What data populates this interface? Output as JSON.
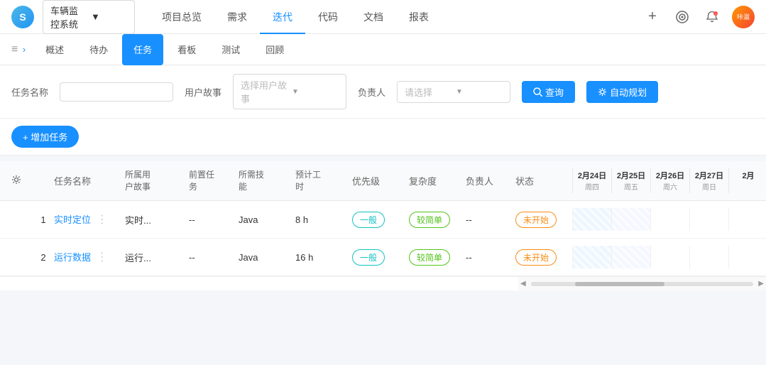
{
  "topNav": {
    "logo": "S",
    "projectSelector": {
      "label": "车辆监控系统",
      "chevron": "▼"
    },
    "navItems": [
      {
        "id": "overview",
        "label": "项目总览",
        "active": false
      },
      {
        "id": "requirements",
        "label": "需求",
        "active": false
      },
      {
        "id": "iteration",
        "label": "迭代",
        "active": true
      },
      {
        "id": "code",
        "label": "代码",
        "active": false
      },
      {
        "id": "docs",
        "label": "文档",
        "active": false
      },
      {
        "id": "reports",
        "label": "报表",
        "active": false
      }
    ],
    "icons": {
      "plus": "+",
      "target": "◎",
      "bell": "①"
    },
    "avatar": "咔滋咔滋嗡"
  },
  "secondNav": {
    "expandIcon": "≡",
    "items": [
      {
        "id": "overview2",
        "label": "概述",
        "active": false
      },
      {
        "id": "pending",
        "label": "待办",
        "active": false
      },
      {
        "id": "task",
        "label": "任务",
        "active": true
      },
      {
        "id": "kanban",
        "label": "看板",
        "active": false
      },
      {
        "id": "test",
        "label": "测试",
        "active": false
      },
      {
        "id": "review",
        "label": "回顾",
        "active": false
      }
    ]
  },
  "filterBar": {
    "taskNameLabel": "任务名称",
    "taskNamePlaceholder": "",
    "userStoryLabel": "用户故事",
    "userStoryPlaceholder": "选择用户故事",
    "assigneeLabel": "负责人",
    "assigneePlaceholder": "请选择",
    "queryBtn": "查询",
    "autoPlanBtn": "自动规划"
  },
  "actionBar": {
    "addTaskBtn": "+ 增加任务"
  },
  "table": {
    "headers": [
      {
        "id": "settings",
        "label": "⚙"
      },
      {
        "id": "num",
        "label": ""
      },
      {
        "id": "name",
        "label": "任务名称"
      },
      {
        "id": "story",
        "label": "所属用\n户故事"
      },
      {
        "id": "pre",
        "label": "前置任\n务"
      },
      {
        "id": "skill",
        "label": "所需技\n能"
      },
      {
        "id": "estimate",
        "label": "预计工\n时"
      },
      {
        "id": "priority",
        "label": "优先级"
      },
      {
        "id": "complexity",
        "label": "复杂度"
      },
      {
        "id": "assignee",
        "label": "负责人"
      },
      {
        "id": "status",
        "label": "状态"
      }
    ],
    "ganttHeaders": [
      {
        "date": "2月24日",
        "weekday": "周四"
      },
      {
        "date": "2月25日",
        "weekday": "周五"
      },
      {
        "date": "2月26日",
        "weekday": "周六"
      },
      {
        "date": "2月27日",
        "weekday": "周日"
      },
      {
        "date": "2月",
        "weekday": ""
      }
    ],
    "rows": [
      {
        "num": "1",
        "name": "实时定位",
        "story": "实时...",
        "pre": "--",
        "skill": "Java",
        "estimate": "8 h",
        "priority": "一般",
        "complexity": "较简单",
        "assignee": "--",
        "status": "未开始",
        "statusColor": "orange",
        "ganttSlots": [
          1,
          1,
          0,
          0,
          0
        ]
      },
      {
        "num": "2",
        "name": "运行数据",
        "story": "运行...",
        "pre": "--",
        "skill": "Java",
        "estimate": "16 h",
        "priority": "一般",
        "complexity": "较简单",
        "assignee": "--",
        "status": "未开始",
        "statusColor": "orange",
        "ganttSlots": [
          1,
          1,
          0,
          0,
          0
        ]
      }
    ]
  }
}
